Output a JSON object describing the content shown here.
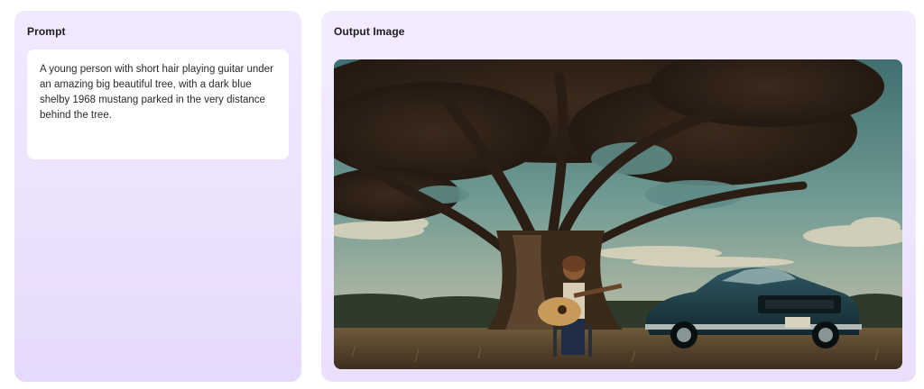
{
  "prompt_panel": {
    "title": "Prompt",
    "text": "A young person with short hair playing guitar under an amazing big beautiful tree, with a dark blue shelby 1968 mustang parked in the very distance behind the tree."
  },
  "output_panel": {
    "title": "Output Image"
  },
  "colors": {
    "panel_bg": "#efe6fd",
    "prompt_box_bg": "#ffffff",
    "title_text": "#1c1c1e",
    "body_text": "#2a2a2e"
  }
}
